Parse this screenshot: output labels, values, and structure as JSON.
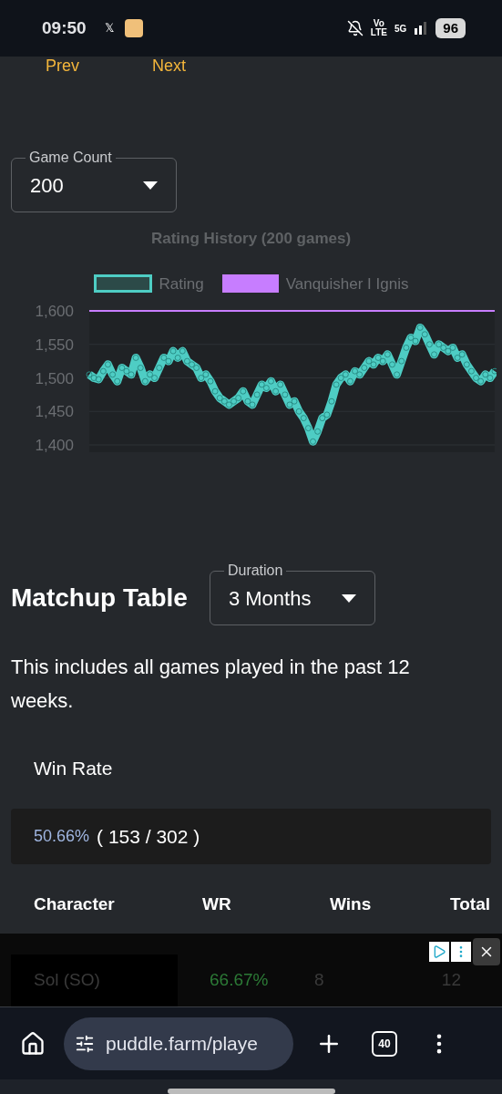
{
  "status_bar": {
    "time": "09:50",
    "app_glyph": "𝕏",
    "network": "Vo\nLTE",
    "signal": "5G",
    "battery": "96"
  },
  "pager": {
    "prev": "Prev",
    "next": "Next"
  },
  "game_count": {
    "label": "Game Count",
    "value": "200"
  },
  "rating_chart": {
    "chart_data": {
      "type": "line",
      "title": "Rating History (200 games)",
      "yticks": [
        {
          "value": 1400,
          "label": "1,400"
        },
        {
          "value": 1450,
          "label": "1,450"
        },
        {
          "value": 1500,
          "label": "1,500"
        },
        {
          "value": 1550,
          "label": "1,550"
        },
        {
          "value": 1600,
          "label": "1,600"
        }
      ],
      "ylim": [
        1400,
        1600
      ],
      "grid": true,
      "legend": true,
      "series": [
        {
          "name": "Rating",
          "color": "#4ecdc4",
          "marker": "circle",
          "values": [
            1505,
            1500,
            1498,
            1510,
            1520,
            1505,
            1495,
            1515,
            1510,
            1505,
            1530,
            1515,
            1495,
            1505,
            1500,
            1515,
            1530,
            1525,
            1540,
            1530,
            1540,
            1525,
            1520,
            1515,
            1500,
            1505,
            1495,
            1480,
            1470,
            1465,
            1460,
            1465,
            1470,
            1480,
            1465,
            1460,
            1475,
            1490,
            1485,
            1495,
            1480,
            1490,
            1475,
            1460,
            1465,
            1450,
            1440,
            1425,
            1405,
            1420,
            1440,
            1445,
            1465,
            1490,
            1500,
            1505,
            1495,
            1510,
            1505,
            1515,
            1525,
            1520,
            1530,
            1525,
            1535,
            1520,
            1505,
            1525,
            1545,
            1560,
            1555,
            1575,
            1565,
            1550,
            1535,
            1550,
            1545,
            1540,
            1545,
            1530,
            1535,
            1520,
            1510,
            1500,
            1495,
            1505,
            1500,
            1510
          ]
        },
        {
          "name": "Vanquisher I Ignis",
          "color": "#c77dff",
          "values": [
            1600,
            1600,
            1600,
            1600,
            1600,
            1600,
            1600,
            1600,
            1600,
            1600,
            1600,
            1600,
            1600,
            1600,
            1600,
            1600,
            1600,
            1600,
            1600,
            1600,
            1600,
            1600,
            1600,
            1600,
            1600,
            1600,
            1600,
            1600,
            1600,
            1600,
            1600,
            1600,
            1600,
            1600,
            1600,
            1600,
            1600,
            1600,
            1600,
            1600,
            1600,
            1600,
            1600,
            1600,
            1600,
            1600,
            1600,
            1600,
            1600,
            1600,
            1600,
            1600,
            1600,
            1600,
            1600,
            1600,
            1600,
            1600,
            1600,
            1600,
            1600,
            1600,
            1600,
            1600,
            1600,
            1600,
            1600,
            1600,
            1600,
            1600,
            1600,
            1600,
            1600,
            1600,
            1600,
            1600,
            1600,
            1600,
            1600,
            1600,
            1600,
            1600,
            1600,
            1600,
            1600,
            1600,
            1600,
            1600
          ]
        }
      ]
    }
  },
  "matchup": {
    "title": "Matchup Table",
    "duration": {
      "label": "Duration",
      "value": "3 Months"
    },
    "description": "This includes all games played in the past 12 weeks.",
    "win_rate_label": "Win Rate",
    "win_rate": {
      "percent": "50.66%",
      "counts": "( 153 / 302 )"
    },
    "table": {
      "columns": [
        "Character",
        "WR",
        "Wins",
        "Total"
      ],
      "rows": [
        [
          "Sol (SO)",
          "66.67%",
          "8",
          "12"
        ]
      ]
    }
  },
  "browser": {
    "url": "puddle.farm/playe",
    "tab_count": "40"
  }
}
